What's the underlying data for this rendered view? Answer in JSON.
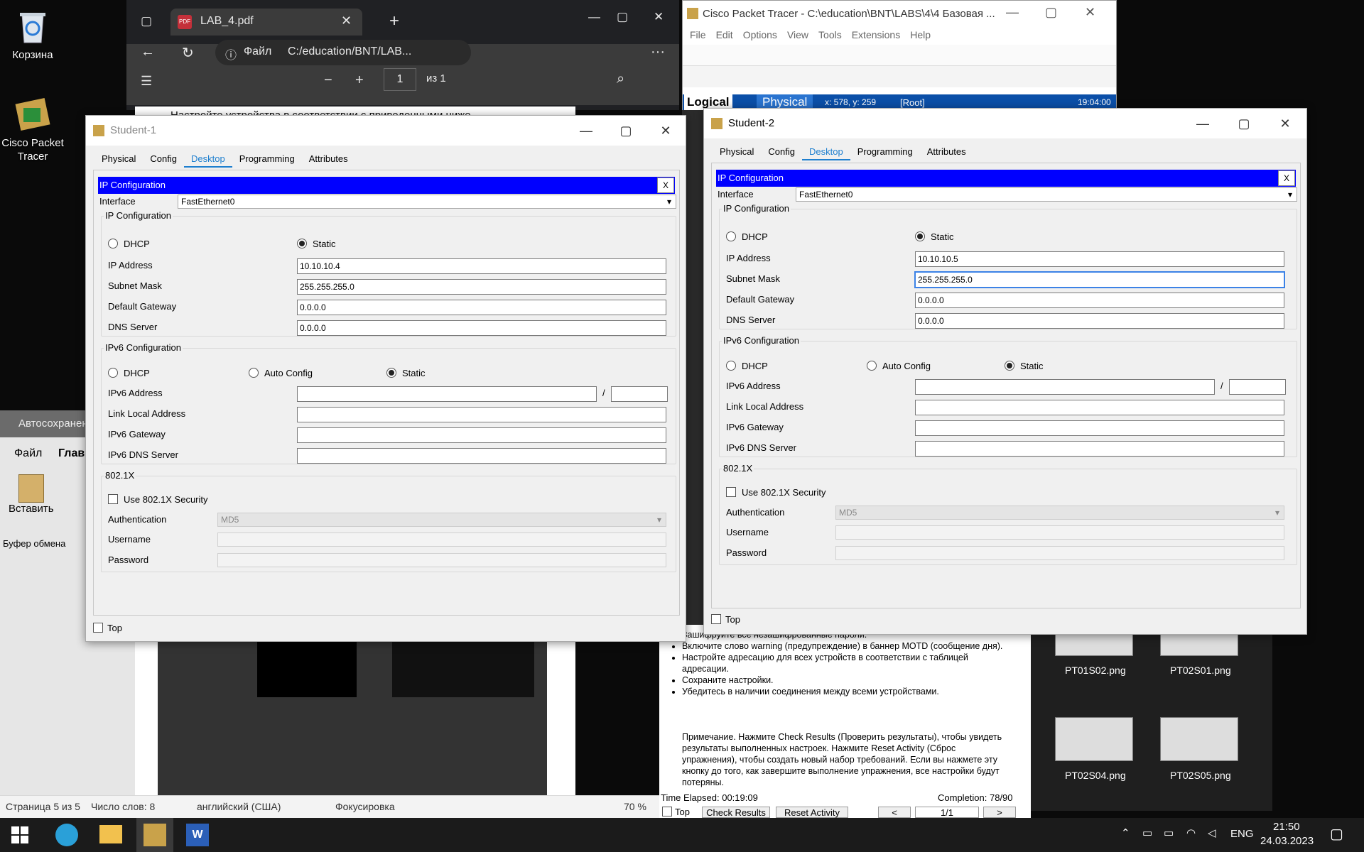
{
  "desktop": {
    "recycle_label": "Корзина",
    "pt_shortcut_label": "Cisco Packet Tracer"
  },
  "edge": {
    "tab_title": "LAB_4.pdf",
    "tab_icon": "pdf-icon",
    "address_label": "Файл",
    "address_value": "C:/education/BNT/LAB...",
    "page_number": "1",
    "page_total": "из 1",
    "doc_text": "Настройте устройства в соответствии с приведенными ниже"
  },
  "word": {
    "title": "Автосохранен",
    "menu_file": "Файл",
    "menu_home": "Глав",
    "paste_label": "Вставить",
    "clipboard_label": "Буфер обмена",
    "status_page": "Страница 5 из 5",
    "status_words": "Число слов: 8",
    "status_lang": "английский (США)",
    "status_focus": "Фокусировка",
    "status_zoom": "70 %"
  },
  "pt_main": {
    "title": "Cisco Packet Tracer - C:\\education\\BNT\\LABS\\4\\4 Базовая ...",
    "menus": [
      "File",
      "Edit",
      "Options",
      "View",
      "Tools",
      "Extensions",
      "Help"
    ],
    "logical": "Logical",
    "physical": "Physical",
    "coords": "x: 578, y: 259",
    "root": "[Root]",
    "clock": "19:04:00"
  },
  "pt_instructions": {
    "bullets": [
      "Зашифруйте все незашифрованные пароли.",
      "Включите слово warning (предупреждение) в баннер MOTD (сообщение дня).",
      "Настройте адресацию для всех устройств в соответствии с таблицей адресации.",
      "Сохраните настройки.",
      "Убедитесь в наличии соединения между всеми устройствами."
    ],
    "note": "Примечание. Нажмите Check Results (Проверить результаты), чтобы увидеть результаты выполненных настроек. Нажмите Reset Activity (Сброс упражнения), чтобы создать новый набор требований. Если вы нажмете эту кнопку до того, как завершите выполнение упражнения, все настройки будут потеряны.",
    "time_elapsed": "Time Elapsed: 00:19:09",
    "completion": "Completion: 78/90",
    "top_label": "Top",
    "check_results": "Check Results",
    "reset_activity": "Reset Activity",
    "prev": "<",
    "page": "1/1",
    "next": ">"
  },
  "explorer": {
    "files": [
      "PT01S02.png",
      "PT02S01.png",
      "PT02S04.png",
      "PT02S05.png"
    ]
  },
  "student1": {
    "title": "Student-1",
    "tabs": [
      "Physical",
      "Config",
      "Desktop",
      "Programming",
      "Attributes"
    ],
    "bar_title": "IP Configuration",
    "close_x": "X",
    "interface_label": "Interface",
    "interface_value": "FastEthernet0",
    "ipv4_group": "IP Configuration",
    "dhcp": "DHCP",
    "static": "Static",
    "ip_label": "IP Address",
    "ip_value": "10.10.10.4",
    "mask_label": "Subnet Mask",
    "mask_value": "255.255.255.0",
    "gw_label": "Default Gateway",
    "gw_value": "0.0.0.0",
    "dns_label": "DNS Server",
    "dns_value": "0.0.0.0",
    "ipv6_group": "IPv6 Configuration",
    "auto_config": "Auto Config",
    "ipv6_addr_label": "IPv6 Address",
    "slash": "/",
    "link_local_label": "Link Local Address",
    "ipv6_gw_label": "IPv6 Gateway",
    "ipv6_dns_label": "IPv6 DNS Server",
    "dot1x_group": "802.1X",
    "use_8021x": "Use 802.1X Security",
    "auth_label": "Authentication",
    "auth_value": "MD5",
    "user_label": "Username",
    "pass_label": "Password",
    "top_label": "Top"
  },
  "student2": {
    "title": "Student-2",
    "tabs": [
      "Physical",
      "Config",
      "Desktop",
      "Programming",
      "Attributes"
    ],
    "bar_title": "IP Configuration",
    "close_x": "X",
    "interface_label": "Interface",
    "interface_value": "FastEthernet0",
    "ipv4_group": "IP Configuration",
    "dhcp": "DHCP",
    "static": "Static",
    "ip_label": "IP Address",
    "ip_value": "10.10.10.5",
    "mask_label": "Subnet Mask",
    "mask_value": "255.255.255.0",
    "gw_label": "Default Gateway",
    "gw_value": "0.0.0.0",
    "dns_label": "DNS Server",
    "dns_value": "0.0.0.0",
    "ipv6_group": "IPv6 Configuration",
    "auto_config": "Auto Config",
    "ipv6_addr_label": "IPv6 Address",
    "slash": "/",
    "link_local_label": "Link Local Address",
    "ipv6_gw_label": "IPv6 Gateway",
    "ipv6_dns_label": "IPv6 DNS Server",
    "dot1x_group": "802.1X",
    "use_8021x": "Use 802.1X Security",
    "auth_label": "Authentication",
    "auth_value": "MD5",
    "user_label": "Username",
    "pass_label": "Password",
    "top_label": "Top"
  },
  "taskbar": {
    "lang": "ENG",
    "time": "21:50",
    "date": "24.03.2023"
  },
  "colors": {
    "accent_blue_bar": "#0000ff",
    "tab_active": "#1e7fcf",
    "taskbar": "#1b1b1b"
  }
}
